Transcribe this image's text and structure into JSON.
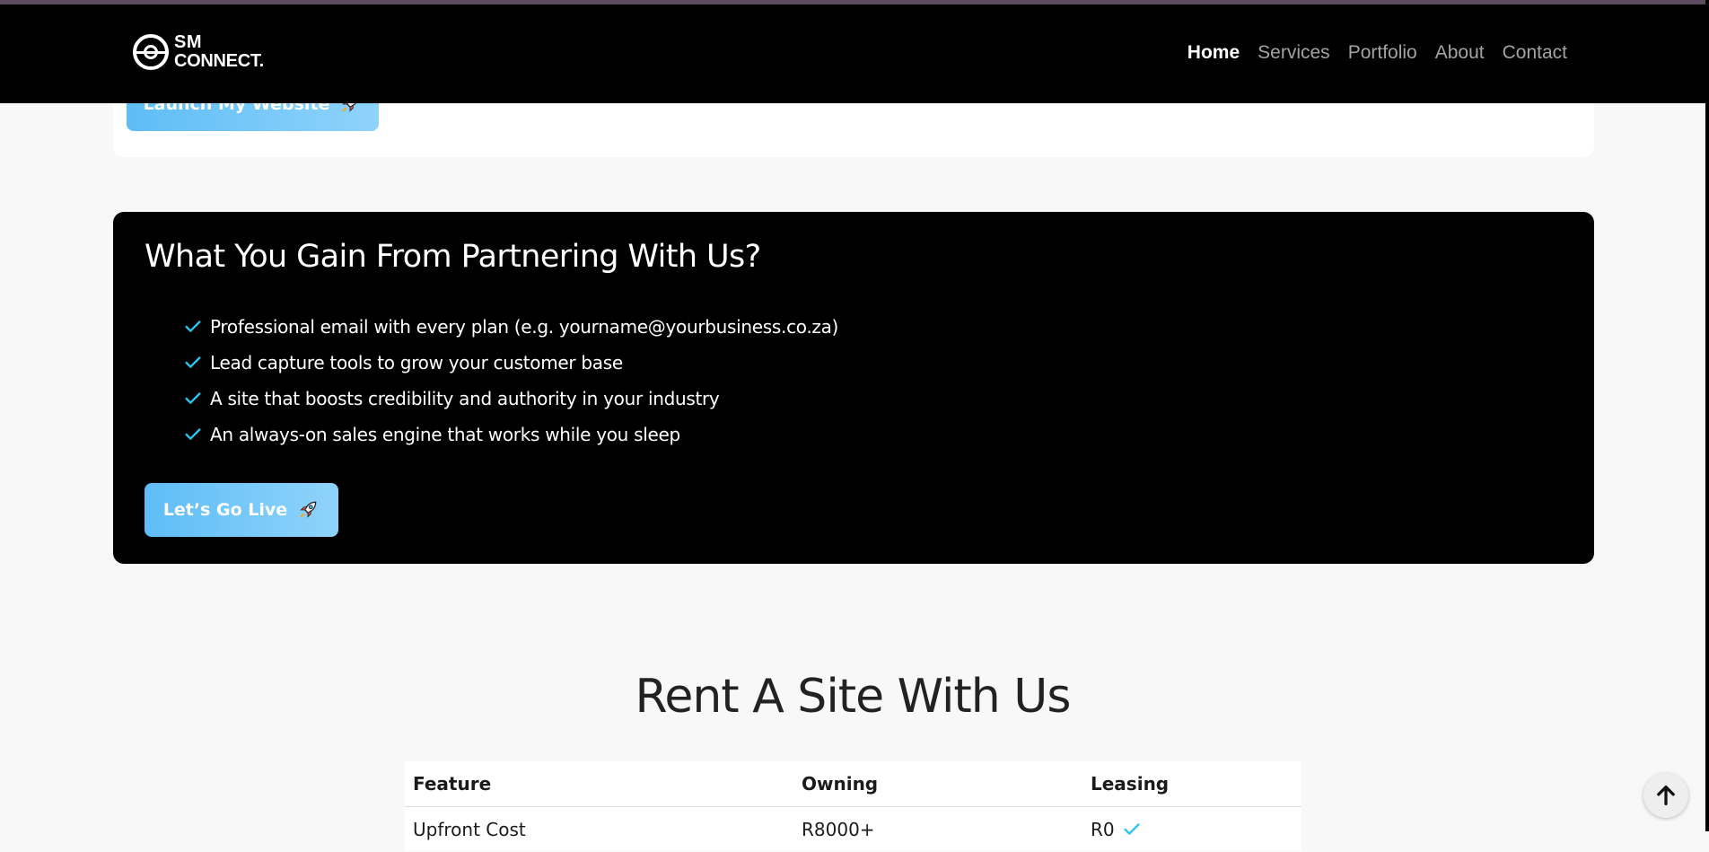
{
  "brand": {
    "line1": "SM",
    "line2": "CONNECT."
  },
  "nav": {
    "home": "Home",
    "services": "Services",
    "portfolio": "Portfolio",
    "about": "About",
    "contact": "Contact"
  },
  "previous_card": {
    "button_label": "Launch My Website"
  },
  "gain": {
    "title": "What You Gain From Partnering With Us?",
    "items": [
      "Professional email with every plan (e.g. yourname@yourbusiness.co.za)",
      "Lead capture tools to grow your customer base",
      "A site that boosts credibility and authority in your industry",
      "An always-on sales engine that works while you sleep"
    ],
    "button_label": "Let’s Go Live"
  },
  "rent": {
    "title": "Rent A Site With Us",
    "columns": [
      "Feature",
      "Owning",
      "Leasing"
    ],
    "rows": [
      [
        "Upfront Cost",
        "R8000+",
        "R0"
      ]
    ]
  },
  "colors": {
    "accent": "#5ebdf6",
    "check": "#2ec4f0",
    "header_bg": "#000000"
  },
  "icons": {
    "check": "check-icon",
    "rocket": "rocket-icon",
    "scroll_top": "arrow-up-icon"
  }
}
